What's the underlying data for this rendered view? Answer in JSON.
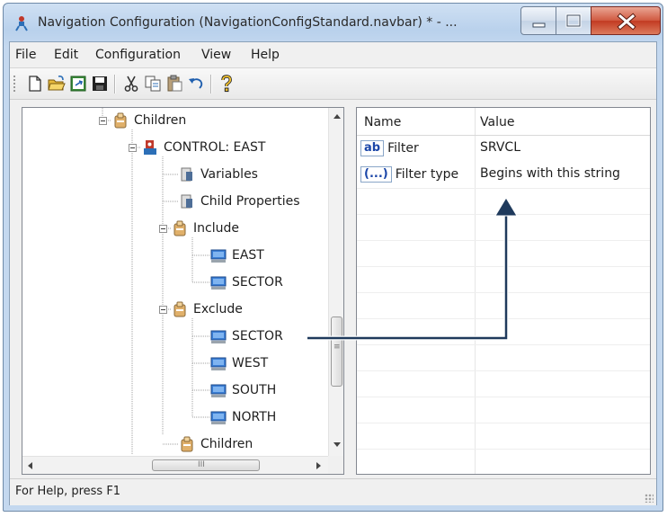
{
  "window": {
    "title": "Navigation Configuration (NavigationConfigStandard.navbar) * - ...",
    "minimize_icon": "minimize-icon",
    "maximize_icon": "maximize-icon",
    "close_icon": "close-icon",
    "close_color": "#c9412a"
  },
  "menu": [
    "File",
    "Edit",
    "Configuration",
    "View",
    "Help"
  ],
  "toolbar": {
    "icons": [
      "new-icon",
      "open-icon",
      "refresh-icon",
      "save-icon",
      "cut-icon",
      "copy-icon",
      "paste-icon",
      "undo-icon",
      "help-icon"
    ]
  },
  "tree": {
    "nodes": [
      {
        "label": "Children",
        "icon": "folder-icon"
      },
      {
        "label": "CONTROL: EAST",
        "icon": "control-icon"
      },
      {
        "label": "Variables",
        "icon": "property-icon"
      },
      {
        "label": "Child Properties",
        "icon": "property-icon"
      },
      {
        "label": "Include",
        "icon": "folder-icon"
      },
      {
        "label": "EAST",
        "icon": "computer-icon"
      },
      {
        "label": "SECTOR",
        "icon": "computer-icon"
      },
      {
        "label": "Exclude",
        "icon": "folder-icon"
      },
      {
        "label": "SECTOR",
        "icon": "computer-icon"
      },
      {
        "label": "WEST",
        "icon": "computer-icon"
      },
      {
        "label": "SOUTH",
        "icon": "computer-icon"
      },
      {
        "label": "NORTH",
        "icon": "computer-icon"
      },
      {
        "label": "Children",
        "icon": "folder-icon"
      }
    ],
    "hscroll_grip": "III"
  },
  "properties": {
    "columns": [
      "Name",
      "Value"
    ],
    "rows": [
      {
        "badge": "ab",
        "name": "Filter",
        "value": "SRVCL"
      },
      {
        "badge": "(...)",
        "name": "Filter type",
        "value": "Begins with this string"
      }
    ]
  },
  "status": {
    "text": "For Help, press F1"
  },
  "annotation": {
    "color": "#1f3a5c",
    "from": "SECTOR",
    "to": "Begins with this string"
  }
}
